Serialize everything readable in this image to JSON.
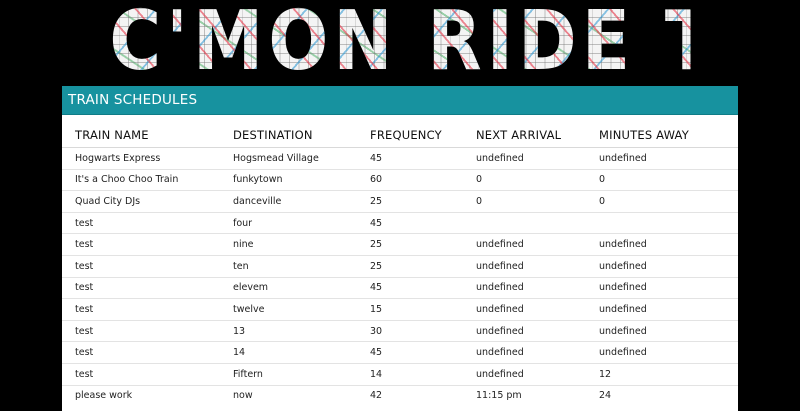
{
  "banner": {
    "title": "C'MON RIDE THE TRAIN!"
  },
  "panel": {
    "title": "TRAIN SCHEDULES"
  },
  "table": {
    "columns": [
      "TRAIN NAME",
      "DESTINATION",
      "FREQUENCY",
      "NEXT ARRIVAL",
      "MINUTES AWAY"
    ],
    "rows": [
      [
        "Hogwarts Express",
        "Hogsmead Village",
        "45",
        "undefined",
        "undefined"
      ],
      [
        "It's a Choo Choo Train",
        "funkytown",
        "60",
        "0",
        "0"
      ],
      [
        "Quad City DJs",
        "danceville",
        "25",
        "0",
        "0"
      ],
      [
        "test",
        "four",
        "45",
        "",
        ""
      ],
      [
        "test",
        "nine",
        "25",
        "undefined",
        "undefined"
      ],
      [
        "test",
        "ten",
        "25",
        "undefined",
        "undefined"
      ],
      [
        "test",
        "elevem",
        "45",
        "undefined",
        "undefined"
      ],
      [
        "test",
        "twelve",
        "15",
        "undefined",
        "undefined"
      ],
      [
        "test",
        "13",
        "30",
        "undefined",
        "undefined"
      ],
      [
        "test",
        "14",
        "45",
        "undefined",
        "undefined"
      ],
      [
        "test",
        "Fiftern",
        "14",
        "undefined",
        "12"
      ],
      [
        "please work",
        "now",
        "42",
        "11:15 pm",
        "24"
      ]
    ]
  },
  "colors": {
    "background": "#000000",
    "header": "#17929f",
    "card": "#ffffff"
  }
}
